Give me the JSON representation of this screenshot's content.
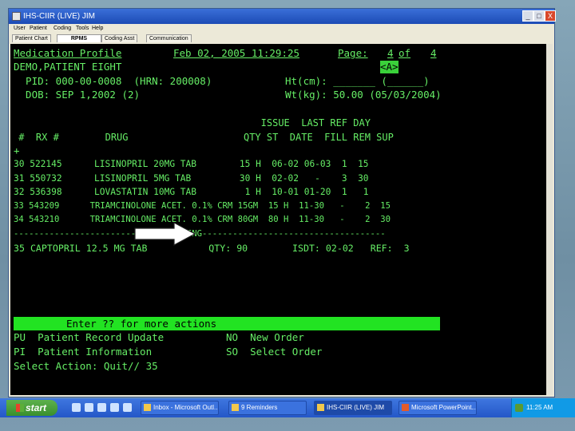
{
  "window": {
    "title": "IHS-CIIR (LIVE) JIM",
    "controls": [
      "_",
      "□",
      "X"
    ]
  },
  "menubar": {
    "items": [
      "User",
      "Patient",
      "Coding",
      "Tools",
      "Help"
    ]
  },
  "tabs": [
    "Patient Chart",
    "RPMS",
    "Coding Asst",
    "Communication"
  ],
  "terminal": {
    "title": "Medication Profile",
    "datetime": "Feb 02, 2005 11:29:25",
    "page_label": "Page:",
    "page_num": "4",
    "page_of": "of",
    "page_total": "4",
    "patient_name": "DEMO,PATIENT EIGHT",
    "nav_indicator": "<A>",
    "pid_line": "  PID: 000-00-0008  (HRN: 200008)",
    "ht_line": "Ht(cm): _______ (______)",
    "dob_line": "  DOB: SEP 1,2002 (2)",
    "wt_line": "Wt(kg): 50.00 (05/03/2004)",
    "col_header_1": "                                           ISSUE  LAST REF DAY",
    "col_header_2": " #  RX #        DRUG                    QTY ST  DATE  FILL REM SUP",
    "plus_marker": "+",
    "rows": [
      "30 522145      LISINOPRIL 20MG TAB        15 H  06-02 06-03  1  15",
      "31 550732      LISINOPRIL 5MG TAB         30 H  02-02   -    3  30",
      "32 536398      LOVASTATIN 10MG TAB         1 H  10-01 01-20  1   1",
      "33 543209      TRIAMCINOLONE ACET. 0.1% CRM 15GM  15 H  11-30   -    2  15",
      "34 543210      TRIAMCINOLONE ACET. 0.1% CRM 80GM  80 H  11-30   -    2  30"
    ],
    "pending_line": "------------------------------PENDING------------------------------------",
    "pending_row": "35 CAPTOPRIL 12.5 MG TAB           QTY: 90        ISDT: 02-02   REF:  3",
    "actions_prompt": "Enter ?? for more actions",
    "action_1_left": "PU  Patient Record Update",
    "action_1_right": "NO  New Order",
    "action_2_left": "PI  Patient Information",
    "action_2_right": "SO  Select Order",
    "select_prompt": "Select Action: Quit// 35"
  },
  "taskbar": {
    "start_label": "start",
    "tasks": [
      "Inbox - Microsoft Outl...",
      "9 Reminders",
      "IHS-CIIR (LIVE) JIM",
      "Microsoft PowerPoint..."
    ],
    "clock": "11:25 AM"
  }
}
